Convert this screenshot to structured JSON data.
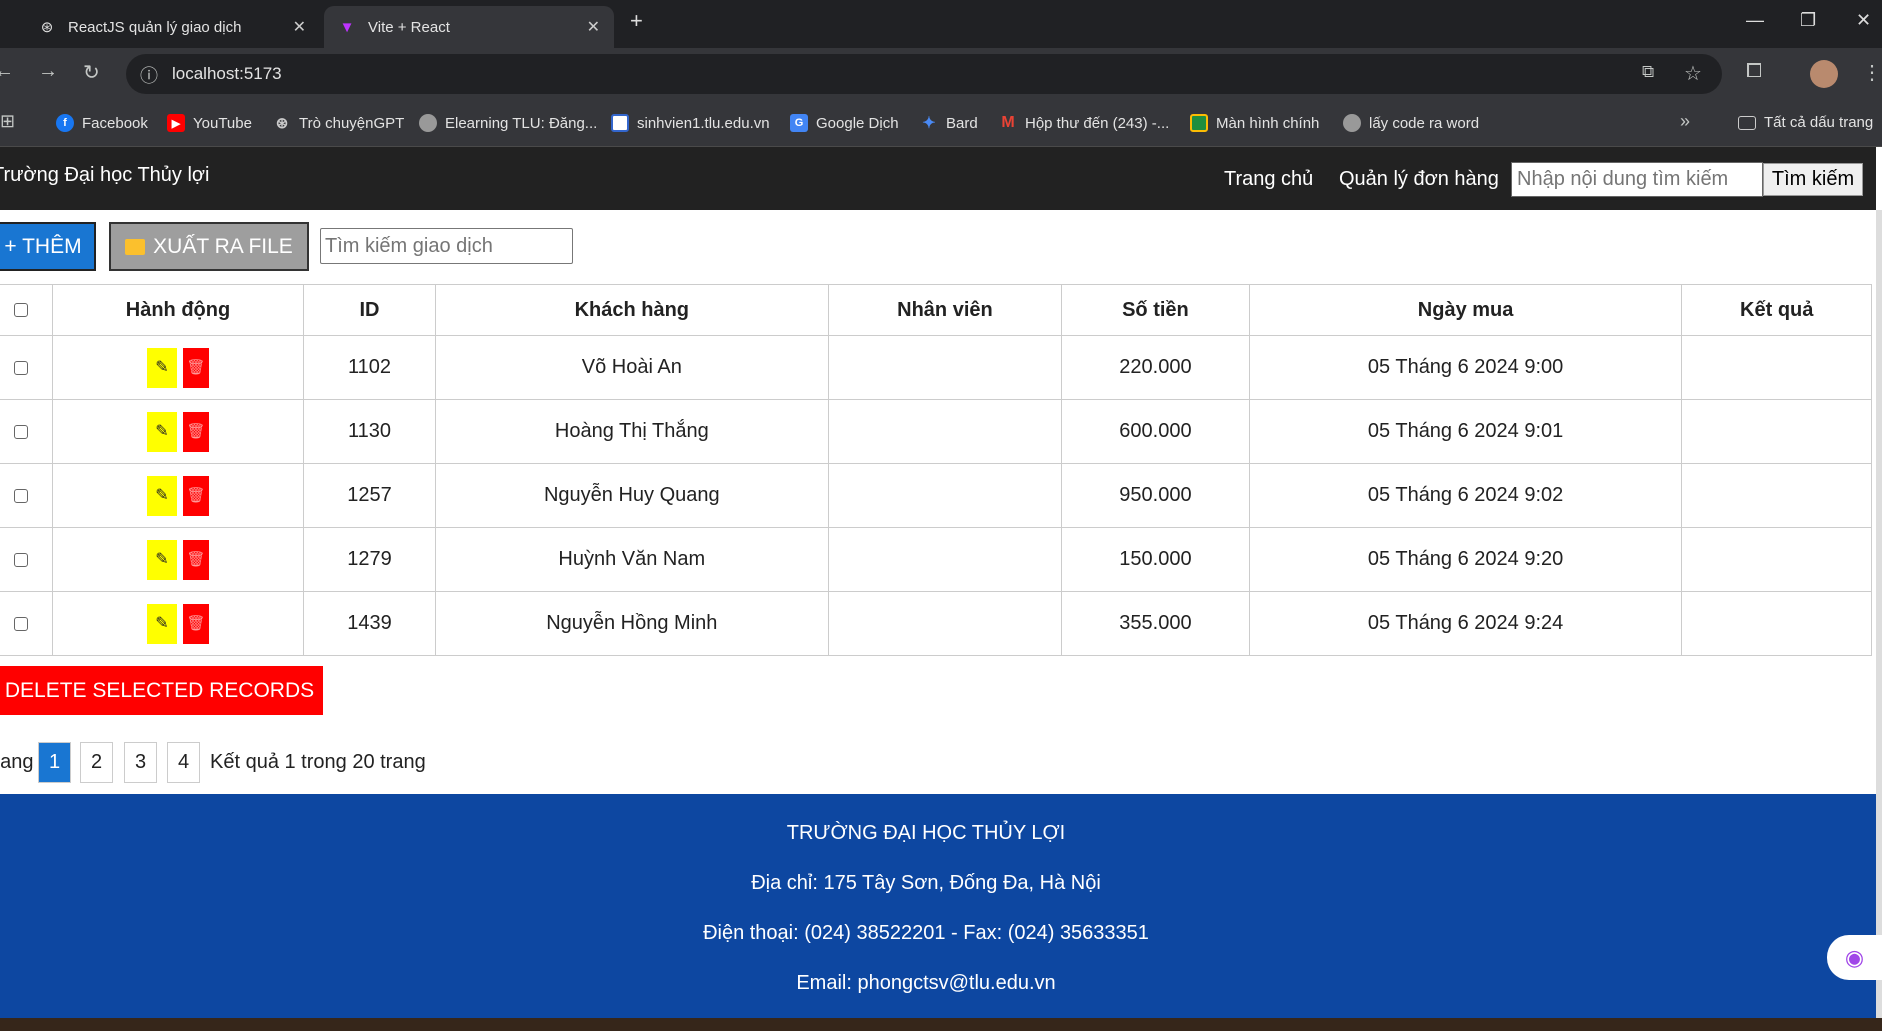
{
  "browser": {
    "tabs": [
      {
        "title": "ReactJS quản lý giao dịch",
        "icon": "chatgpt-icon"
      },
      {
        "title": "Vite + React",
        "icon": "vite-icon",
        "active": true
      }
    ],
    "url": "localhost:5173",
    "bookmarks": [
      {
        "label": "Facebook",
        "icon": "facebook-icon",
        "color": "#1877f2"
      },
      {
        "label": "YouTube",
        "icon": "youtube-icon",
        "color": "#ff0000"
      },
      {
        "label": "Trò chuyệnGPT",
        "icon": "chatgpt-icon",
        "color": "#888888"
      },
      {
        "label": "Elearning TLU: Đăng...",
        "icon": "globe-icon",
        "color": "#777777"
      },
      {
        "label": "sinhvien1.tlu.edu.vn",
        "icon": "tlu-icon",
        "color": "#3366cc"
      },
      {
        "label": "Google Dịch",
        "icon": "google-translate-icon",
        "color": "#4285f4"
      },
      {
        "label": "Bard",
        "icon": "bard-icon",
        "color": "#4a8af4"
      },
      {
        "label": "Hộp thư đến (243) -...",
        "icon": "gmail-icon",
        "color": "#ea4335"
      },
      {
        "label": "Màn hình chính",
        "icon": "classroom-icon",
        "color": "#1e8e3e"
      },
      {
        "label": "lấy code ra word",
        "icon": "globe-icon",
        "color": "#777777"
      }
    ],
    "all_bookmarks": "Tất cả dấu trang"
  },
  "header": {
    "brand": "Trường Đại học Thủy lợi",
    "nav": [
      "Trang chủ",
      "Quản lý đơn hàng"
    ],
    "search_placeholder": "Nhập nội dung tìm kiếm",
    "search_button": "Tìm kiếm"
  },
  "toolbar": {
    "add": "+ THÊM",
    "export": "XUẤT RA FILE",
    "search_placeholder": "Tìm kiếm giao dịch"
  },
  "table": {
    "columns": [
      "Hành động",
      "ID",
      "Khách hàng",
      "Nhân viên",
      "Số tiền",
      "Ngày mua",
      "Kết quả"
    ],
    "rows": [
      {
        "id": "1102",
        "customer": "Võ Hoài An",
        "employee": "",
        "amount": "220.000",
        "date": "05 Tháng 6 2024 9:00",
        "result": ""
      },
      {
        "id": "1130",
        "customer": "Hoàng Thị Thắng",
        "employee": "",
        "amount": "600.000",
        "date": "05 Tháng 6 2024 9:01",
        "result": ""
      },
      {
        "id": "1257",
        "customer": "Nguyễn Huy Quang",
        "employee": "",
        "amount": "950.000",
        "date": "05 Tháng 6 2024 9:02",
        "result": ""
      },
      {
        "id": "1279",
        "customer": "Huỳnh Văn Nam",
        "employee": "",
        "amount": "150.000",
        "date": "05 Tháng 6 2024 9:20",
        "result": ""
      },
      {
        "id": "1439",
        "customer": "Nguyễn Hồng Minh",
        "employee": "",
        "amount": "355.000",
        "date": "05 Tháng 6 2024 9:24",
        "result": ""
      }
    ]
  },
  "delete_selected": "DELETE SELECTED RECORDS",
  "pagination": {
    "label": "Trang",
    "pages": [
      "1",
      "2",
      "3",
      "4"
    ],
    "current": "1",
    "info": "Kết quả 1 trong 20 trang"
  },
  "footer": {
    "name": "TRƯỜNG ĐẠI HỌC THỦY LỢI",
    "address": "Địa chỉ: 175 Tây Sơn, Đống Đa, Hà Nội",
    "phone": "Điện thoại: (024) 38522201 - Fax: (024) 35633351",
    "email": "Email: phongctsv@tlu.edu.vn"
  },
  "colors": {
    "primary": "#1976d2",
    "danger": "#ff0000",
    "edit": "#ffff00",
    "footer": "#0d47a1",
    "header": "#222222"
  }
}
